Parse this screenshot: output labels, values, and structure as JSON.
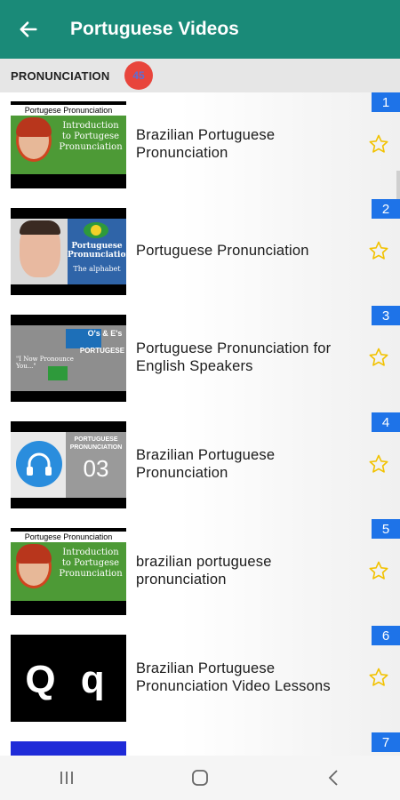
{
  "appbar": {
    "title": "Portuguese Videos"
  },
  "section": {
    "label": "PRONUNCIATION",
    "count": "45"
  },
  "videos": [
    {
      "index": "1",
      "title": "Brazilian Portuguese Pronunciation",
      "thumb_caption": "Portugese Pronunciation",
      "thumb_text": "Introduction to Portugese Pronunciation"
    },
    {
      "index": "2",
      "title": "Portuguese Pronunciation",
      "thumb_text": "Portuguese Pronunciation",
      "thumb_sub": "The alphabet"
    },
    {
      "index": "3",
      "title": "Portuguese Pronunciation for English Speakers",
      "thumb_text": "O's & E's",
      "thumb_brand": "PORTUGESE",
      "thumb_quote": "\"I Now Pronounce You...\""
    },
    {
      "index": "4",
      "title": "Brazilian Portuguese Pronunciation",
      "thumb_text": "PORTUGUESE PRONUNCIATION",
      "thumb_num": "03"
    },
    {
      "index": "5",
      "title": "brazilian portuguese pronunciation",
      "thumb_caption": "Portugese Pronunciation",
      "thumb_text": "Introduction to Portugese Pronunciation"
    },
    {
      "index": "6",
      "title": "Brazilian Portuguese Pronunciation Video Lessons",
      "thumb_text": "Q q"
    },
    {
      "index": "7",
      "title": ""
    }
  ],
  "colors": {
    "appbar": "#1a8a78",
    "badge": "#1e73e8",
    "count_badge": "#e8453c",
    "star": "#f2c200"
  },
  "icons": {
    "back": "arrow-left-icon",
    "favorite": "star-outline-icon",
    "recents": "recents-icon",
    "home": "home-icon",
    "nav_back": "chevron-left-icon"
  }
}
